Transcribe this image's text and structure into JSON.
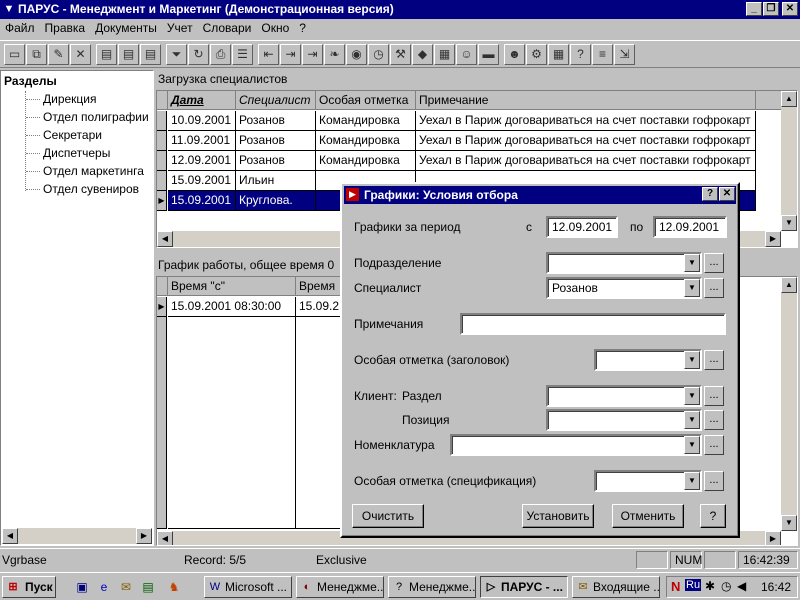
{
  "window": {
    "title": "ПАРУС - Менеджмент и Маркетинг (Демонстрационная версия)"
  },
  "menu": [
    {
      "label": "Файл"
    },
    {
      "label": "Правка"
    },
    {
      "label": "Документы"
    },
    {
      "label": "Учет"
    },
    {
      "label": "Словари"
    },
    {
      "label": "Окно"
    },
    {
      "label": "?"
    }
  ],
  "sidebar": {
    "title": "Разделы",
    "items": [
      {
        "label": "Дирекция"
      },
      {
        "label": "Отдел полиграфии"
      },
      {
        "label": "Секретари"
      },
      {
        "label": "Диспетчеры"
      },
      {
        "label": "Отдел маркетинга"
      },
      {
        "label": "Отдел сувениров"
      }
    ]
  },
  "top_pane": {
    "title": "Загрузка специалистов",
    "columns": [
      "Дата",
      "Специалист",
      "Особая отметка",
      "Примечание"
    ],
    "rows": [
      [
        "10.09.2001",
        "Розанов",
        "Командировка",
        "Уехал в Париж договариваться на счет поставки гофрокарт"
      ],
      [
        "11.09.2001",
        "Розанов",
        "Командировка",
        "Уехал в Париж договариваться на счет поставки гофрокарт"
      ],
      [
        "12.09.2001",
        "Розанов",
        "Командировка",
        "Уехал в Париж договариваться на счет поставки гофрокарт"
      ],
      [
        "15.09.2001",
        "Ильин",
        "",
        ""
      ],
      [
        "15.09.2001",
        "Круглова.",
        "",
        ""
      ]
    ]
  },
  "bottom_pane": {
    "title": "График работы, общее время 0",
    "columns": [
      "Время \"с\"",
      "Время"
    ],
    "rows": [
      [
        "15.09.2001 08:30:00",
        "15.09.2"
      ]
    ]
  },
  "dialog": {
    "title": "Графики: Условия отбора",
    "help_label": "?",
    "close_label": "✕",
    "period_label": "Графики за период",
    "from_label": "с",
    "from_value": "12.09.2001",
    "to_label": "по",
    "to_value": "12.09.2001",
    "department_label": "Подразделение",
    "department_value": "",
    "specialist_label": "Специалист",
    "specialist_value": "Розанов",
    "notes_label": "Примечания",
    "notes_value": "",
    "mark_header_label": "Особая отметка (заголовок)",
    "mark_header_value": "",
    "client_label": "Клиент:",
    "section_label": "Раздел",
    "section_value": "",
    "position_label": "Позиция",
    "position_value": "",
    "nomenclature_label": "Номенклатура",
    "nomenclature_value": "",
    "mark_spec_label": "Особая отметка (спецификация)",
    "mark_spec_value": "",
    "ellipsis": "...",
    "clear_label": "Очистить",
    "set_label": "Установить",
    "cancel_label": "Отменить",
    "help_button_label": "?"
  },
  "status": {
    "db": "Vgrbase",
    "record": "Record: 5/5",
    "mode": "Exclusive",
    "num": "NUM",
    "time": "16:42:39"
  },
  "taskbar": {
    "start": "Пуск",
    "tasks": [
      {
        "label": "Microsoft ..."
      },
      {
        "label": "Менеджме..."
      },
      {
        "label": "Менеджме..."
      },
      {
        "label": "ПАРУС - ..."
      },
      {
        "label": "Входящие ..."
      }
    ],
    "lang": "Ru",
    "clock": "16:42"
  },
  "colors": {
    "titlebar": "#000080",
    "selection": "#000080",
    "face": "#c0c0c0"
  }
}
